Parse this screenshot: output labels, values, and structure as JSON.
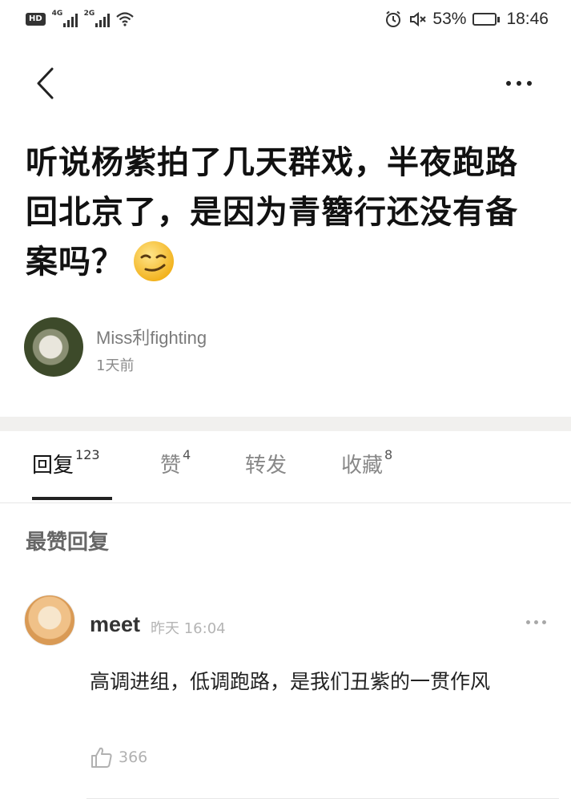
{
  "status_bar": {
    "hd": "HD",
    "sim1_gen": "4G",
    "sim2_gen": "2G",
    "alarm_icon": "alarm-icon",
    "mute_icon": "mute-icon",
    "battery_percent": "53%",
    "battery_level": 0.53,
    "time": "18:46"
  },
  "nav": {
    "back_icon": "chevron-left-icon",
    "more_icon": "more-horizontal-icon"
  },
  "post": {
    "title": "听说杨紫拍了几天群戏，半夜跑路回北京了，是因为青簪行还没有备案吗？",
    "title_emoji": "smirking-face-emoji",
    "author": "Miss利fighting",
    "time": "1天前"
  },
  "tabs": [
    {
      "label": "回复",
      "count": "123"
    },
    {
      "label": "赞",
      "count": "4"
    },
    {
      "label": "转发",
      "count": ""
    },
    {
      "label": "收藏",
      "count": "8"
    }
  ],
  "section_title": "最赞回复",
  "comments": [
    {
      "user": "meet",
      "time": "昨天 16:04",
      "text": "高调进组，低调跑路，是我们丑紫的一贯作风",
      "likes": "366",
      "like_icon": "thumbs-up-icon",
      "more_icon": "more-horizontal-icon"
    }
  ]
}
